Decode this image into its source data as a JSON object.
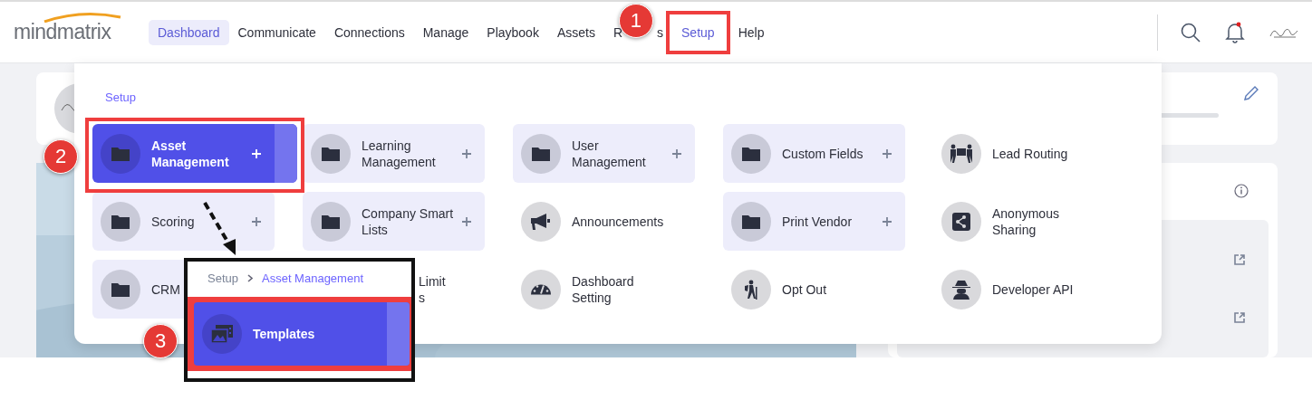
{
  "header": {
    "logo": "mindmatrix",
    "nav": [
      {
        "label": "Dashboard",
        "selected": true,
        "open": false
      },
      {
        "label": "Communicate",
        "selected": false,
        "open": false
      },
      {
        "label": "Connections",
        "selected": false,
        "open": false
      },
      {
        "label": "Manage",
        "selected": false,
        "open": false
      },
      {
        "label": "Playbook",
        "selected": false,
        "open": false
      },
      {
        "label": "Assets",
        "selected": false,
        "open": false
      },
      {
        "label": "R",
        "tail": "s",
        "selected": false,
        "open": false
      },
      {
        "label": "Setup",
        "selected": false,
        "open": true
      },
      {
        "label": "Help",
        "selected": false,
        "open": false
      }
    ],
    "notification_dot": true
  },
  "setup_menu": {
    "breadcrumb": "Setup",
    "items": [
      {
        "label": "Asset Management",
        "kind": "group",
        "expandable": true,
        "selected": true
      },
      {
        "label": "Learning Management",
        "kind": "group",
        "expandable": true,
        "selected": false
      },
      {
        "label": "User Management",
        "kind": "group",
        "expandable": true,
        "selected": false
      },
      {
        "label": "Custom Fields",
        "kind": "group",
        "expandable": true,
        "selected": false
      },
      {
        "label": "Lead Routing",
        "kind": "link",
        "expandable": false,
        "selected": false
      },
      {
        "label": "Scoring",
        "kind": "group",
        "expandable": true,
        "selected": false
      },
      {
        "label": "Company Smart Lists",
        "kind": "group",
        "expandable": true,
        "selected": false
      },
      {
        "label": "Announcements",
        "kind": "link",
        "expandable": false,
        "selected": false
      },
      {
        "label": "Print Vendor",
        "kind": "group",
        "expandable": true,
        "selected": false
      },
      {
        "label": "Anonymous Sharing",
        "kind": "link",
        "expandable": false,
        "selected": false
      },
      {
        "label": "CRM",
        "kind": "group",
        "selected": false
      },
      {
        "label": "Limit\ns",
        "kind": "partial",
        "selected": false
      },
      {
        "label": "Dashboard Setting",
        "kind": "link",
        "expandable": false,
        "selected": false
      },
      {
        "label": "Opt Out",
        "kind": "link",
        "expandable": false,
        "selected": false
      },
      {
        "label": "Developer API",
        "kind": "link",
        "expandable": false,
        "selected": false
      }
    ]
  },
  "callout": {
    "breadcrumb": [
      "Setup",
      "Asset Management"
    ],
    "item": {
      "label": "Templates",
      "selected": true
    }
  },
  "annotations": [
    {
      "number": "1"
    },
    {
      "number": "2"
    },
    {
      "number": "3"
    }
  ]
}
